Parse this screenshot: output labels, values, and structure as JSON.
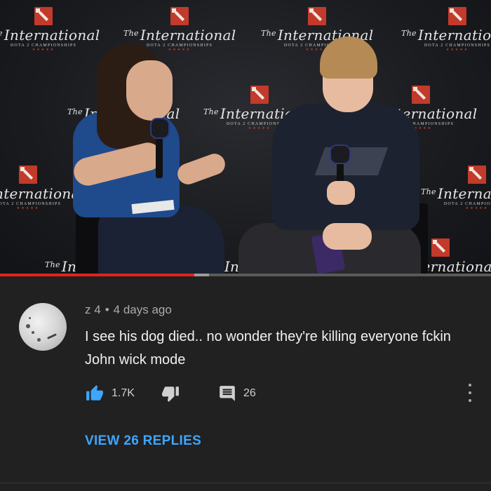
{
  "video": {
    "backdrop_logo": {
      "the": "The",
      "name": "International",
      "subtitle": "DOTA 2 CHAMPIONSHIPS",
      "stars": "★★★★★"
    },
    "progress_fraction": 0.395,
    "buffer_fraction": 0.425,
    "colors": {
      "progress": "#e62117",
      "buffer": "#9b9b9b",
      "track": "#5a5a5a"
    }
  },
  "comment": {
    "author": "z 4",
    "separator": "•",
    "time": "4 days ago",
    "text": "I see his dog died.. no wonder they're killing everyone fckin John wick mode",
    "likes": "1.7K",
    "replies_count": "26",
    "view_replies_label": "VIEW 26 REPLIES",
    "icons": {
      "like": "thumbs-up-icon",
      "dislike": "thumbs-down-icon",
      "reply": "comment-icon",
      "more": "more-vertical-icon"
    },
    "colors": {
      "like_active": "#3ea6ff",
      "link": "#3ea6ff",
      "meta": "#aaaaaa"
    }
  }
}
